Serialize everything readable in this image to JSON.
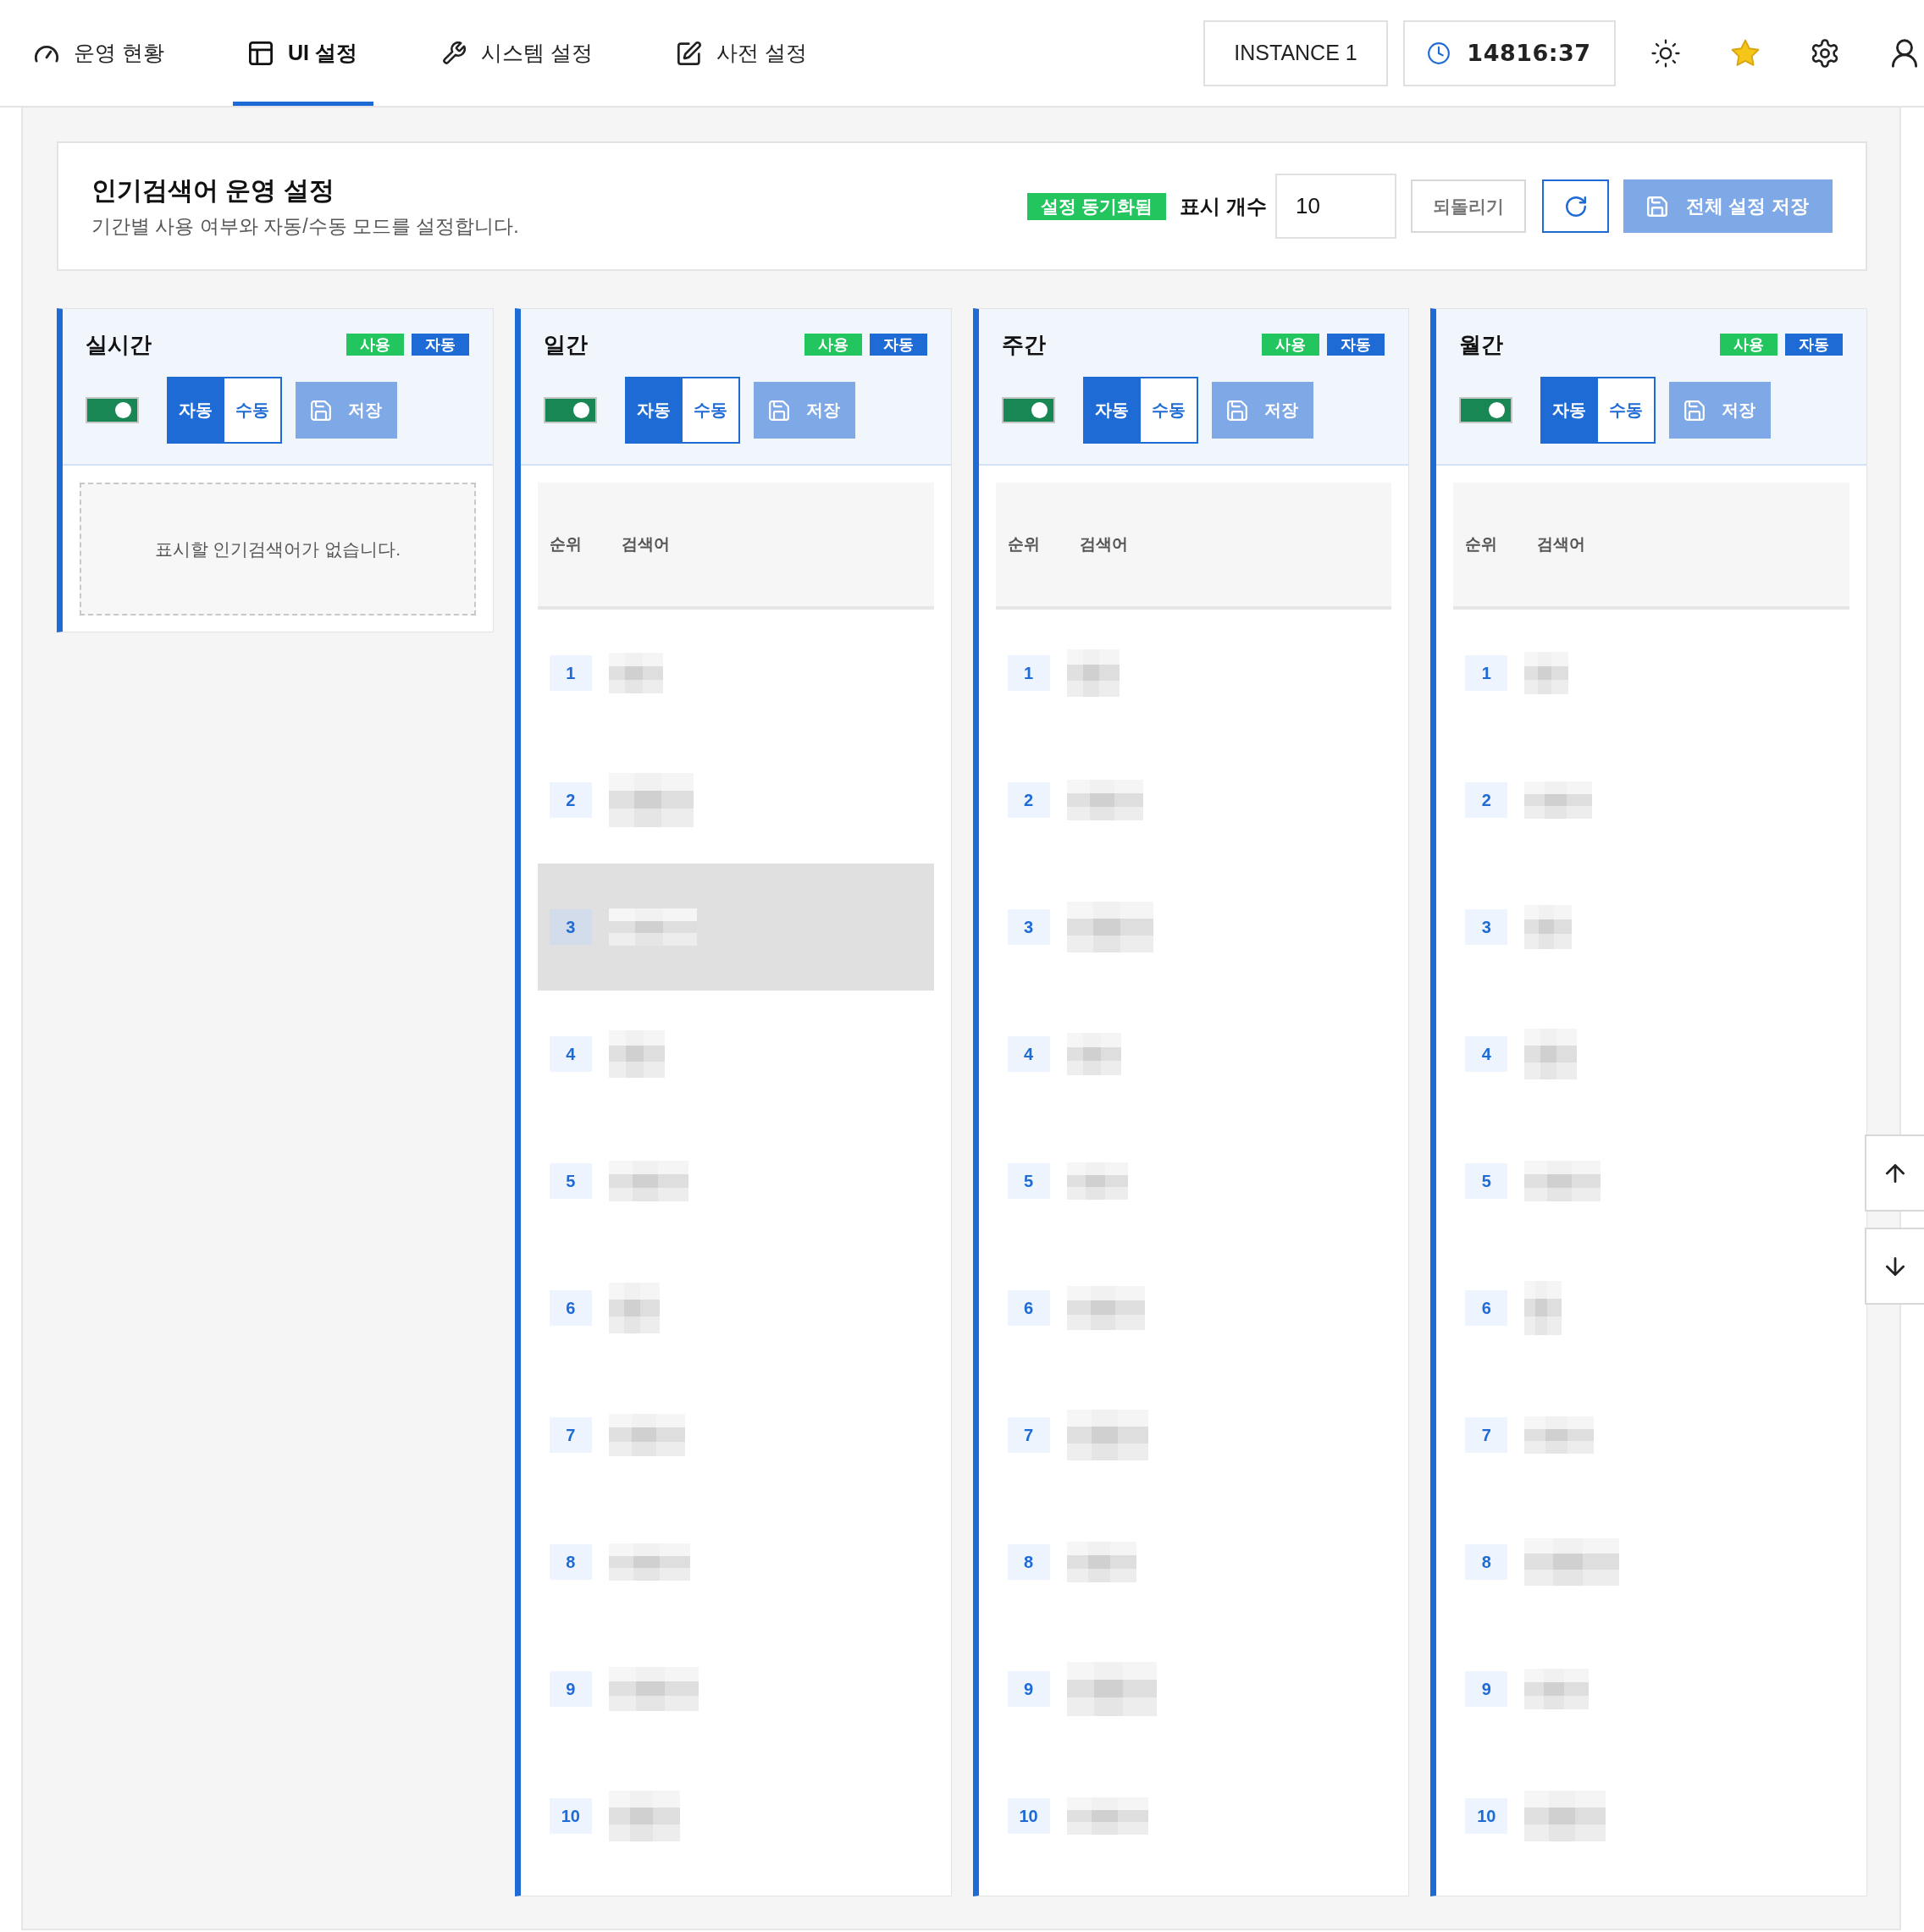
{
  "nav": {
    "tabs": [
      {
        "label": "운영 현황",
        "selected": false
      },
      {
        "label": "UI 설정",
        "selected": true
      },
      {
        "label": "시스템 설정",
        "selected": false
      },
      {
        "label": "사전 설정",
        "selected": false
      }
    ],
    "instance": "INSTANCE 1",
    "clock": "14816:37"
  },
  "header": {
    "title": "인기검색어 운영 설정",
    "subtitle": "기간별 사용 여부와 자동/수동 모드를 설정합니다.",
    "sync_badge": "설정 동기화됨",
    "display_count": {
      "label": "표시 개수",
      "value": "10"
    },
    "revert_button": "되돌리기",
    "save_all_button": {
      "label": "전체 설정 저장",
      "disabled": true
    }
  },
  "panels": [
    {
      "title": "실시간",
      "badges": [
        {
          "label": "사용",
          "color": "#22c55e"
        },
        {
          "label": "자동",
          "color": "#1e6bd6"
        }
      ],
      "enabled": true,
      "modes": [
        {
          "label": "자동",
          "selected": true
        },
        {
          "label": "수동",
          "selected": false
        }
      ],
      "save_button": {
        "label": "저장",
        "disabled": true
      },
      "empty_message": "표시할 인기검색어가 없습니다."
    },
    {
      "title": "일간",
      "badges": [
        {
          "label": "사용",
          "color": "#22c55e"
        },
        {
          "label": "자동",
          "color": "#1e6bd6"
        }
      ],
      "enabled": true,
      "modes": [
        {
          "label": "자동",
          "selected": true
        },
        {
          "label": "수동",
          "selected": false
        }
      ],
      "save_button": {
        "label": "저장",
        "disabled": true
      },
      "table": {
        "columns": [
          "순위",
          "검색어"
        ],
        "rows": [
          {
            "rank": "1",
            "selected": false
          },
          {
            "rank": "2",
            "selected": false
          },
          {
            "rank": "3",
            "selected": true
          },
          {
            "rank": "4",
            "selected": false
          },
          {
            "rank": "5",
            "selected": false
          },
          {
            "rank": "6",
            "selected": false
          },
          {
            "rank": "7",
            "selected": false
          },
          {
            "rank": "8",
            "selected": false
          },
          {
            "rank": "9",
            "selected": false
          },
          {
            "rank": "10",
            "selected": false
          }
        ]
      }
    },
    {
      "title": "주간",
      "badges": [
        {
          "label": "사용",
          "color": "#22c55e"
        },
        {
          "label": "자동",
          "color": "#1e6bd6"
        }
      ],
      "enabled": true,
      "modes": [
        {
          "label": "자동",
          "selected": true
        },
        {
          "label": "수동",
          "selected": false
        }
      ],
      "save_button": {
        "label": "저장",
        "disabled": true
      },
      "table": {
        "columns": [
          "순위",
          "검색어"
        ],
        "rows": [
          {
            "rank": "1",
            "selected": false
          },
          {
            "rank": "2",
            "selected": false
          },
          {
            "rank": "3",
            "selected": false
          },
          {
            "rank": "4",
            "selected": false
          },
          {
            "rank": "5",
            "selected": false
          },
          {
            "rank": "6",
            "selected": false
          },
          {
            "rank": "7",
            "selected": false
          },
          {
            "rank": "8",
            "selected": false
          },
          {
            "rank": "9",
            "selected": false
          },
          {
            "rank": "10",
            "selected": false
          }
        ]
      }
    },
    {
      "title": "월간",
      "badges": [
        {
          "label": "사용",
          "color": "#22c55e"
        },
        {
          "label": "자동",
          "color": "#1e6bd6"
        }
      ],
      "enabled": true,
      "modes": [
        {
          "label": "자동",
          "selected": true
        },
        {
          "label": "수동",
          "selected": false
        }
      ],
      "save_button": {
        "label": "저장",
        "disabled": true
      },
      "table": {
        "columns": [
          "순위",
          "검색어"
        ],
        "rows": [
          {
            "rank": "1",
            "selected": false
          },
          {
            "rank": "2",
            "selected": false
          },
          {
            "rank": "3",
            "selected": false
          },
          {
            "rank": "4",
            "selected": false
          },
          {
            "rank": "5",
            "selected": false
          },
          {
            "rank": "6",
            "selected": false
          },
          {
            "rank": "7",
            "selected": false
          },
          {
            "rank": "8",
            "selected": false
          },
          {
            "rank": "9",
            "selected": false
          },
          {
            "rank": "10",
            "selected": false
          }
        ]
      }
    }
  ]
}
